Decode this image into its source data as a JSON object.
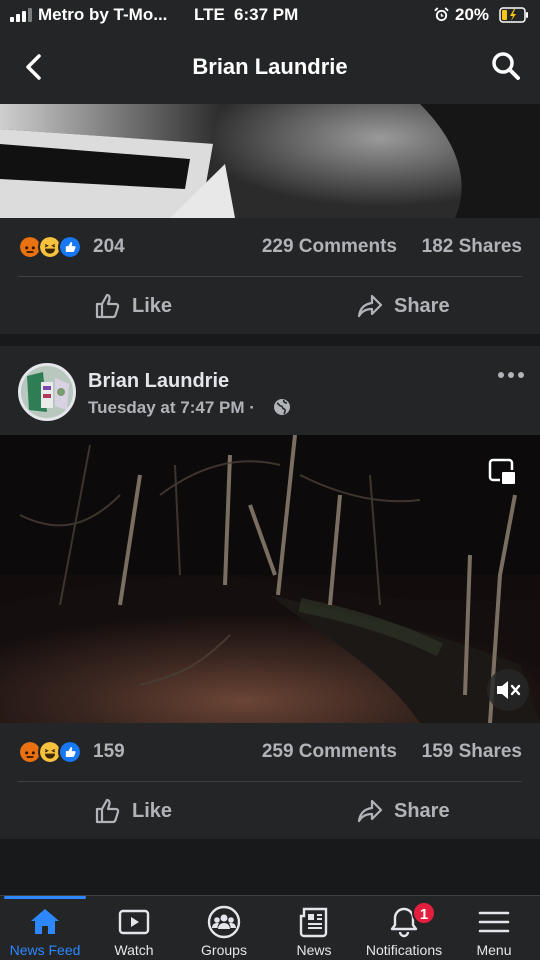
{
  "status_bar": {
    "carrier": "Metro by T-Mo...",
    "network": "LTE",
    "time": "6:37 PM",
    "battery": "20%",
    "icons": [
      "signal-icon",
      "alarm-icon",
      "battery-charging-icon"
    ]
  },
  "header": {
    "title": "Brian Laundrie",
    "icons": [
      "back-arrow-icon",
      "search-icon"
    ]
  },
  "posts": [
    {
      "reactions": [
        "angry",
        "haha",
        "like"
      ],
      "reaction_count": "204",
      "comments": "229 Comments",
      "shares": "182 Shares",
      "actions": {
        "like": "Like",
        "share": "Share"
      }
    },
    {
      "author": "Brian Laundrie",
      "time": "Tuesday at 7:47 PM ·",
      "privacy_icon": "globe-icon",
      "reactions": [
        "angry",
        "haha",
        "like"
      ],
      "reaction_count": "159",
      "comments": "259 Comments",
      "shares": "159 Shares",
      "actions": {
        "like": "Like",
        "share": "Share"
      }
    }
  ],
  "tab_bar": {
    "tabs": [
      {
        "label": "News Feed",
        "icon": "home-icon",
        "active": true
      },
      {
        "label": "Watch",
        "icon": "video-icon",
        "active": false
      },
      {
        "label": "Groups",
        "icon": "groups-icon",
        "active": false
      },
      {
        "label": "News",
        "icon": "newspaper-icon",
        "active": false
      },
      {
        "label": "Notifications",
        "icon": "bell-icon",
        "active": false,
        "badge": "1"
      },
      {
        "label": "Menu",
        "icon": "hamburger-icon",
        "active": false
      }
    ]
  },
  "colors": {
    "background": "#18191a",
    "surface": "#242526",
    "accent": "#2d88ff",
    "badge": "#e41e3f"
  }
}
